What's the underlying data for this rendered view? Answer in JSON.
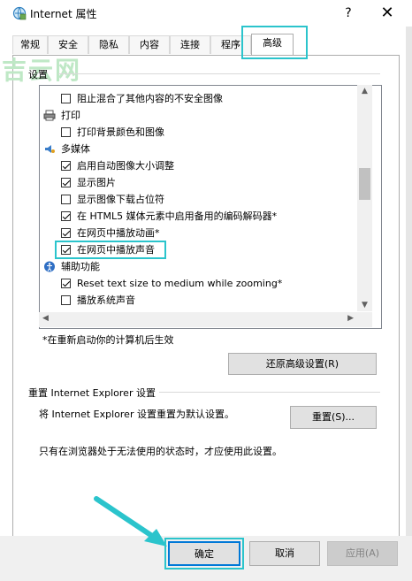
{
  "window": {
    "title": "Internet 属性",
    "help_label": "?",
    "close_label": "✕"
  },
  "tabs": [
    "常规",
    "安全",
    "隐私",
    "内容",
    "连接",
    "程序",
    "高级"
  ],
  "active_tab": "高级",
  "watermark": "吉云网",
  "settings": {
    "label": "设置",
    "rows": [
      {
        "type": "checkbox",
        "checked": false,
        "label": "阻止混合了其他内容的不安全图像"
      },
      {
        "type": "category",
        "icon": "printer-icon",
        "label": "打印"
      },
      {
        "type": "checkbox",
        "checked": false,
        "label": "打印背景颜色和图像"
      },
      {
        "type": "category",
        "icon": "multimedia-icon",
        "label": "多媒体"
      },
      {
        "type": "checkbox",
        "checked": true,
        "label": "启用自动图像大小调整"
      },
      {
        "type": "checkbox",
        "checked": true,
        "label": "显示图片"
      },
      {
        "type": "checkbox",
        "checked": false,
        "label": "显示图像下载占位符"
      },
      {
        "type": "checkbox",
        "checked": true,
        "label": "在 HTML5 媒体元素中启用备用的编码解码器*"
      },
      {
        "type": "checkbox",
        "checked": true,
        "label": "在网页中播放动画*"
      },
      {
        "type": "checkbox",
        "checked": true,
        "label": "在网页中播放声音"
      },
      {
        "type": "category",
        "icon": "accessibility-icon",
        "label": "辅助功能"
      },
      {
        "type": "checkbox",
        "checked": true,
        "label": "Reset text size to medium while zooming*"
      },
      {
        "type": "checkbox",
        "checked": false,
        "label": "播放系统声音"
      }
    ]
  },
  "restart_note": "*在重新启动你的计算机后生效",
  "restore_button": "还原高级设置(R)",
  "reset": {
    "section_title": "重置 Internet Explorer 设置",
    "description": "将 Internet Explorer 设置重置为默认设置。",
    "button": "重置(S)...",
    "warning": "只有在浏览器处于无法使用的状态时，才应使用此设置。"
  },
  "footer": {
    "ok": "确定",
    "cancel": "取消",
    "apply": "应用(A)"
  },
  "highlight_color": "#2bc4cc"
}
